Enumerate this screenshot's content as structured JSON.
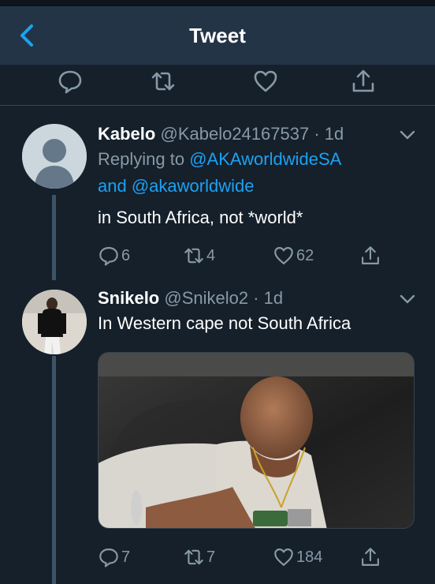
{
  "header": {
    "title": "Tweet"
  },
  "tweets": [
    {
      "name": "Kabelo",
      "handle": "@Kabelo24167537",
      "time": "· 1d",
      "replying_prefix": "Replying to",
      "mention_1": "@AKAworldwideSA",
      "and": "and",
      "mention_2": "@akaworldwide",
      "text": "in South Africa, not *world*",
      "replies": "6",
      "retweets": "4",
      "likes": "62"
    },
    {
      "name": "Snikelo",
      "handle": "@Snikelo2",
      "time": "· 1d",
      "text": "In Western cape not South Africa",
      "replies": "7",
      "retweets": "7",
      "likes": "184"
    }
  ],
  "colors": {
    "background": "#15202b",
    "header": "#243447",
    "accent": "#1da1f2",
    "muted": "#8899a6"
  }
}
